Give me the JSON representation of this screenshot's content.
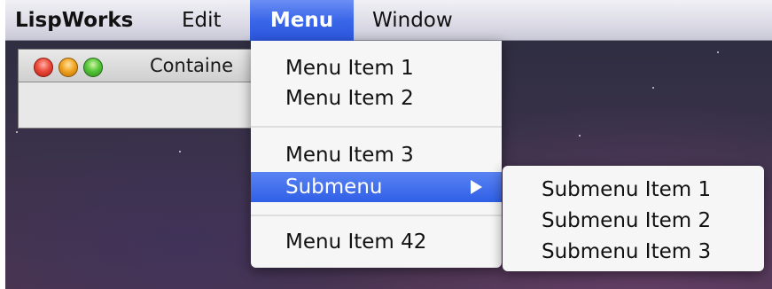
{
  "menubar": {
    "app_name": "LispWorks",
    "edit": "Edit",
    "menu": "Menu",
    "window": "Window"
  },
  "window": {
    "title": "Containe"
  },
  "dropdown": {
    "items": [
      {
        "label": "Menu Item 1"
      },
      {
        "label": "Menu Item 2"
      },
      {
        "label": "Menu Item 3"
      },
      {
        "label": "Submenu"
      },
      {
        "label": "Menu Item 42"
      }
    ]
  },
  "submenu": {
    "items": [
      {
        "label": "Submenu Item 1"
      },
      {
        "label": "Submenu Item 2"
      },
      {
        "label": "Submenu Item 3"
      }
    ]
  },
  "colors": {
    "highlight": "#3a66e8",
    "menu_bg": "#f6f6f6"
  }
}
